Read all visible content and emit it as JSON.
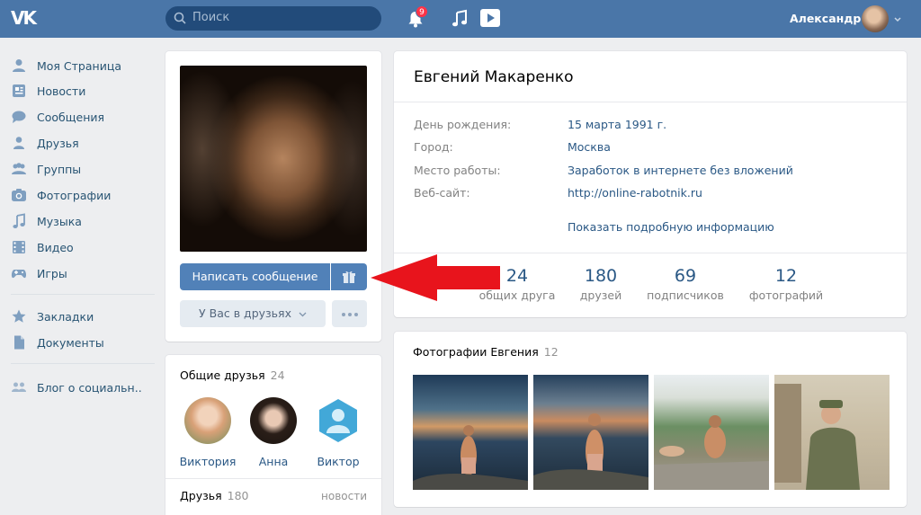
{
  "header": {
    "logo_text": "VK",
    "search_placeholder": "Поиск",
    "notifications_count": "9",
    "user_name": "Александр"
  },
  "nav": {
    "items": [
      {
        "label": "Моя Страница",
        "icon": "user-icon"
      },
      {
        "label": "Новости",
        "icon": "news-icon"
      },
      {
        "label": "Сообщения",
        "icon": "message-icon"
      },
      {
        "label": "Друзья",
        "icon": "friend-icon"
      },
      {
        "label": "Группы",
        "icon": "groups-icon"
      },
      {
        "label": "Фотографии",
        "icon": "camera-icon"
      },
      {
        "label": "Музыка",
        "icon": "music-icon"
      },
      {
        "label": "Видео",
        "icon": "video-icon"
      },
      {
        "label": "Игры",
        "icon": "gamepad-icon"
      },
      {
        "label": "Закладки",
        "icon": "star-icon"
      },
      {
        "label": "Документы",
        "icon": "document-icon"
      },
      {
        "label": "Блог о социальн..",
        "icon": "community-icon"
      }
    ]
  },
  "profile": {
    "name": "Евгений Макаренко",
    "write_message": "Написать сообщение",
    "in_friends": "У Вас в друзьях",
    "fields": [
      {
        "label": "День рождения:",
        "value": "15 марта 1991 г."
      },
      {
        "label": "Город:",
        "value": "Москва"
      },
      {
        "label": "Место работы:",
        "value": "Заработок в интернете без вложений"
      },
      {
        "label": "Веб-сайт:",
        "value": "http://online-rabotnik.ru"
      }
    ],
    "show_more": "Показать подробную информацию",
    "stats": [
      {
        "number": "24",
        "label": "общих друга"
      },
      {
        "number": "180",
        "label": "друзей"
      },
      {
        "number": "69",
        "label": "подписчиков"
      },
      {
        "number": "12",
        "label": "фотографий"
      }
    ]
  },
  "mutual": {
    "title": "Общие друзья",
    "count": "24",
    "friends": [
      "Виктория",
      "Анна",
      "Виктор"
    ]
  },
  "friends_block": {
    "title": "Друзья",
    "count": "180",
    "link": "новости"
  },
  "photos": {
    "title": "Фотографии Евгения",
    "count": "12"
  },
  "colors": {
    "header": "#4a76a8",
    "accent_button": "#5181b8",
    "link": "#2a5885",
    "annotation_arrow": "#e8141c"
  }
}
